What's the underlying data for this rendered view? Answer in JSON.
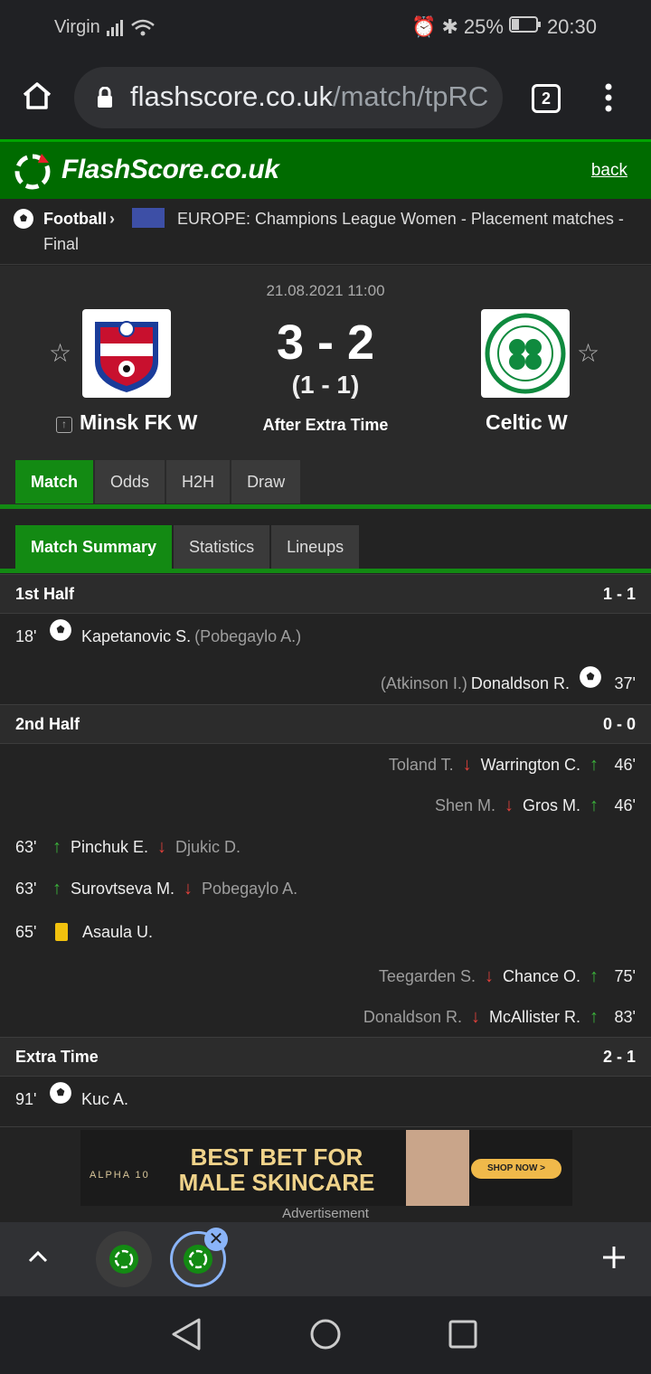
{
  "status": {
    "carrier": "Virgin",
    "battery": "25%",
    "time": "20:30"
  },
  "browser": {
    "url_main": "flashscore.co.uk",
    "url_path": "/match/tpRC",
    "tab_count": "2"
  },
  "header": {
    "logo_text": "FlashScore.co.uk",
    "back": "back"
  },
  "breadcrumb": {
    "sport": "Football",
    "competition": "EUROPE: Champions League Women - Placement matches - Final"
  },
  "match": {
    "datetime": "21.08.2021 11:00",
    "home": "Minsk FK W",
    "away": "Celtic W",
    "score": "3 - 2",
    "ht_score": "(1 - 1)",
    "status": "After Extra Time"
  },
  "tabs": [
    "Match",
    "Odds",
    "H2H",
    "Draw"
  ],
  "subtabs": [
    "Match Summary",
    "Statistics",
    "Lineups"
  ],
  "sections": [
    {
      "title": "1st Half",
      "score": "1 - 1"
    },
    {
      "title": "2nd Half",
      "score": "0 - 0"
    },
    {
      "title": "Extra Time",
      "score": "2 - 1"
    }
  ],
  "events": [
    {
      "minute": "18'",
      "player": "Kapetanovic S.",
      "extra": "(Pobegaylo A.)"
    },
    {
      "minute": "37'",
      "player": "Donaldson R.",
      "extra": "(Atkinson I.)"
    },
    {
      "minute": "46'",
      "in": "Warrington C.",
      "out": "Toland T."
    },
    {
      "minute": "46'",
      "in": "Gros M.",
      "out": "Shen M."
    },
    {
      "minute": "63'",
      "in": "Pinchuk E.",
      "out": "Djukic D."
    },
    {
      "minute": "63'",
      "in": "Surovtseva M.",
      "out": "Pobegaylo A."
    },
    {
      "minute": "65'",
      "player": "Asaula U."
    },
    {
      "minute": "75'",
      "in": "Chance O.",
      "out": "Teegarden S."
    },
    {
      "minute": "83'",
      "in": "McAllister R.",
      "out": "Donaldson R."
    },
    {
      "minute": "91'",
      "player": "Kuc A."
    }
  ],
  "ad": {
    "brand": "ALPHA 10",
    "headline1": "BEST BET FOR",
    "headline2": "MALE SKINCARE",
    "cta": "SHOP NOW >",
    "label": "Advertisement"
  }
}
